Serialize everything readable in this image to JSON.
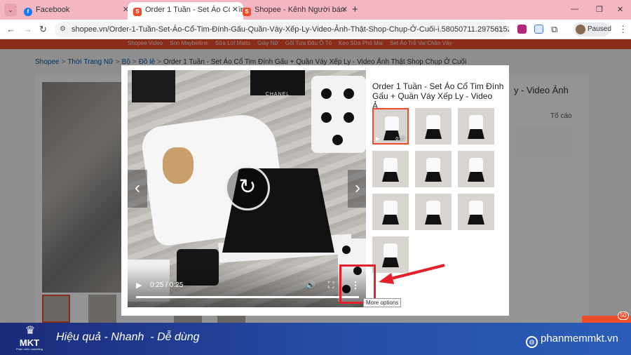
{
  "tabs": [
    {
      "title": "Facebook",
      "favicon": "facebook-icon",
      "color": "#1877f2",
      "active": false
    },
    {
      "title": "Order 1 Tuần - Set Áo Cổ Tim Đ",
      "favicon": "shopee-icon",
      "color": "#ee4d2d",
      "active": true
    },
    {
      "title": "Shopee - Kênh Người bán",
      "favicon": "shopee-icon",
      "color": "#ee4d2d",
      "active": false
    }
  ],
  "address": {
    "url": "shopee.vn/Order-1-Tuần-Set-Áo-Cổ-Tim-Đính-Gấu-Quần-Váy-Xếp-Ly-Video-Ảnh-Thật-Shop-Chụp-Ở-Cuối-i.58050711.29756152196?sp_atk=7e...",
    "profile_status": "Paused"
  },
  "navbar": [
    "Shopee Video",
    "Son Maybelline",
    "Sữa Lof Malto",
    "Giày Nữ",
    "Gối Tựa Đầu Ô Tô",
    "Kẹo Sữa Phô Mai",
    "Set Áo Trễ Vai Chân Váy"
  ],
  "breadcrumb": [
    "Shopee",
    "Thời Trang Nữ",
    "Bộ",
    "Đồ lẻ",
    "Order 1 Tuần - Set Áo Cổ Tim Đính Gấu + Quần Váy Xếp Ly - Video Ảnh Thật Shop Chụp Ở Cuối"
  ],
  "background": {
    "title_partial": "y - Video Ảnh",
    "report": "Tố cáo"
  },
  "modal": {
    "title": "Order 1 Tuần - Set Áo Cổ Tim Đính Gấu + Quần Váy Xếp Ly - Video Ả...",
    "video": {
      "time": "0:25 / 0:25",
      "progress": 1.0,
      "tooltip": "More options"
    },
    "thumbnail_count": 10,
    "first_thumb_duration": "0:25"
  },
  "banner": {
    "brand": "MKT",
    "brand_sub": "Phần mềm marketing",
    "slogan": "Hiệu quả - Nhanh  - Dễ dùng",
    "website": "phanmemmkt.vn"
  },
  "chat": {
    "badge": "50"
  },
  "colors": {
    "shopee": "#ee4d2d",
    "tabstrip": "#f5b6c3",
    "highlight": "#e4202a"
  }
}
